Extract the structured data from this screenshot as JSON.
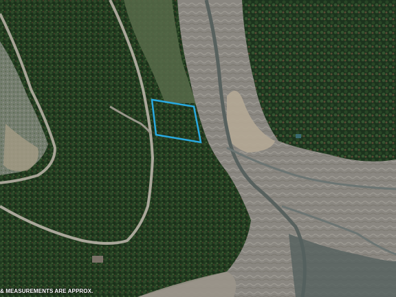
{
  "map": {
    "type": "aerial-satellite-image",
    "parcel_outline_color": "#29a9e0",
    "disclaimer": "& MEASUREMENTS ARE APPROX."
  }
}
